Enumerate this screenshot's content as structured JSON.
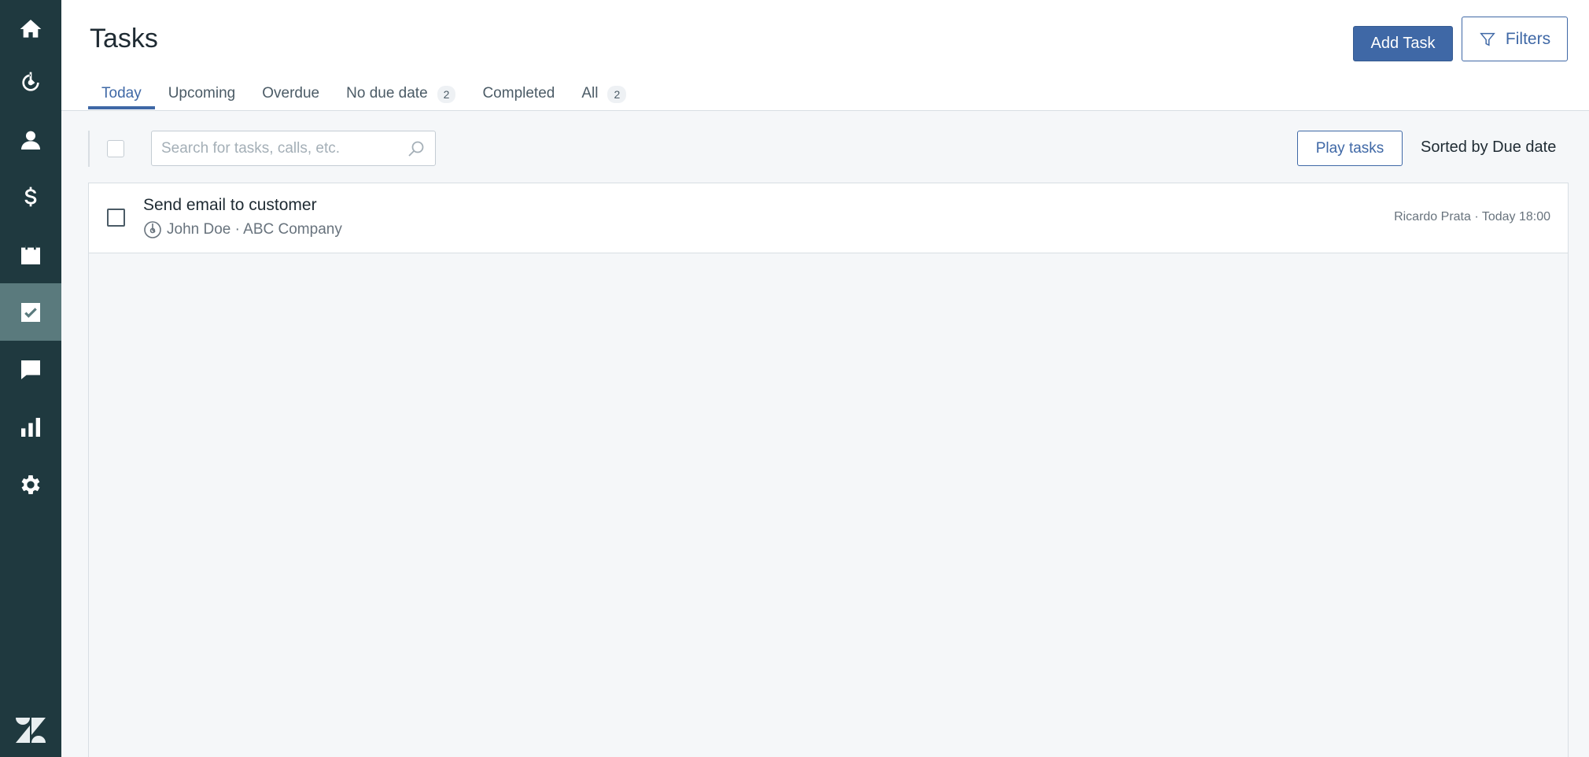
{
  "page": {
    "title": "Tasks"
  },
  "header": {
    "add_task_label": "Add Task",
    "filters_label": "Filters"
  },
  "tabs": [
    {
      "label": "Today",
      "badge": ""
    },
    {
      "label": "Upcoming",
      "badge": ""
    },
    {
      "label": "Overdue",
      "badge": ""
    },
    {
      "label": "No due date",
      "badge": "2"
    },
    {
      "label": "Completed",
      "badge": ""
    },
    {
      "label": "All",
      "badge": "2"
    }
  ],
  "toolbar": {
    "search_placeholder": "Search for tasks, calls, etc.",
    "search_value": "",
    "play_label": "Play tasks",
    "sorted_prefix": "Sorted by",
    "sorted_value": "Due date"
  },
  "tasks": [
    {
      "title": "Send email to customer",
      "contact": "John Doe · ABC Company",
      "owner_due": "Ricardo Prata · Today 18:00"
    }
  ],
  "colors": {
    "sidebar": "#1f393f",
    "sidebar_active": "#5a7a7d",
    "accent": "#3f68a6"
  },
  "icons": [
    "home-icon",
    "leads-icon",
    "contacts-icon",
    "dollar-icon",
    "calendar-icon",
    "tasks-icon",
    "chat-icon",
    "reports-icon",
    "settings-icon",
    "zendesk-logo-icon",
    "filter-icon",
    "search-icon",
    "lead-icon"
  ]
}
